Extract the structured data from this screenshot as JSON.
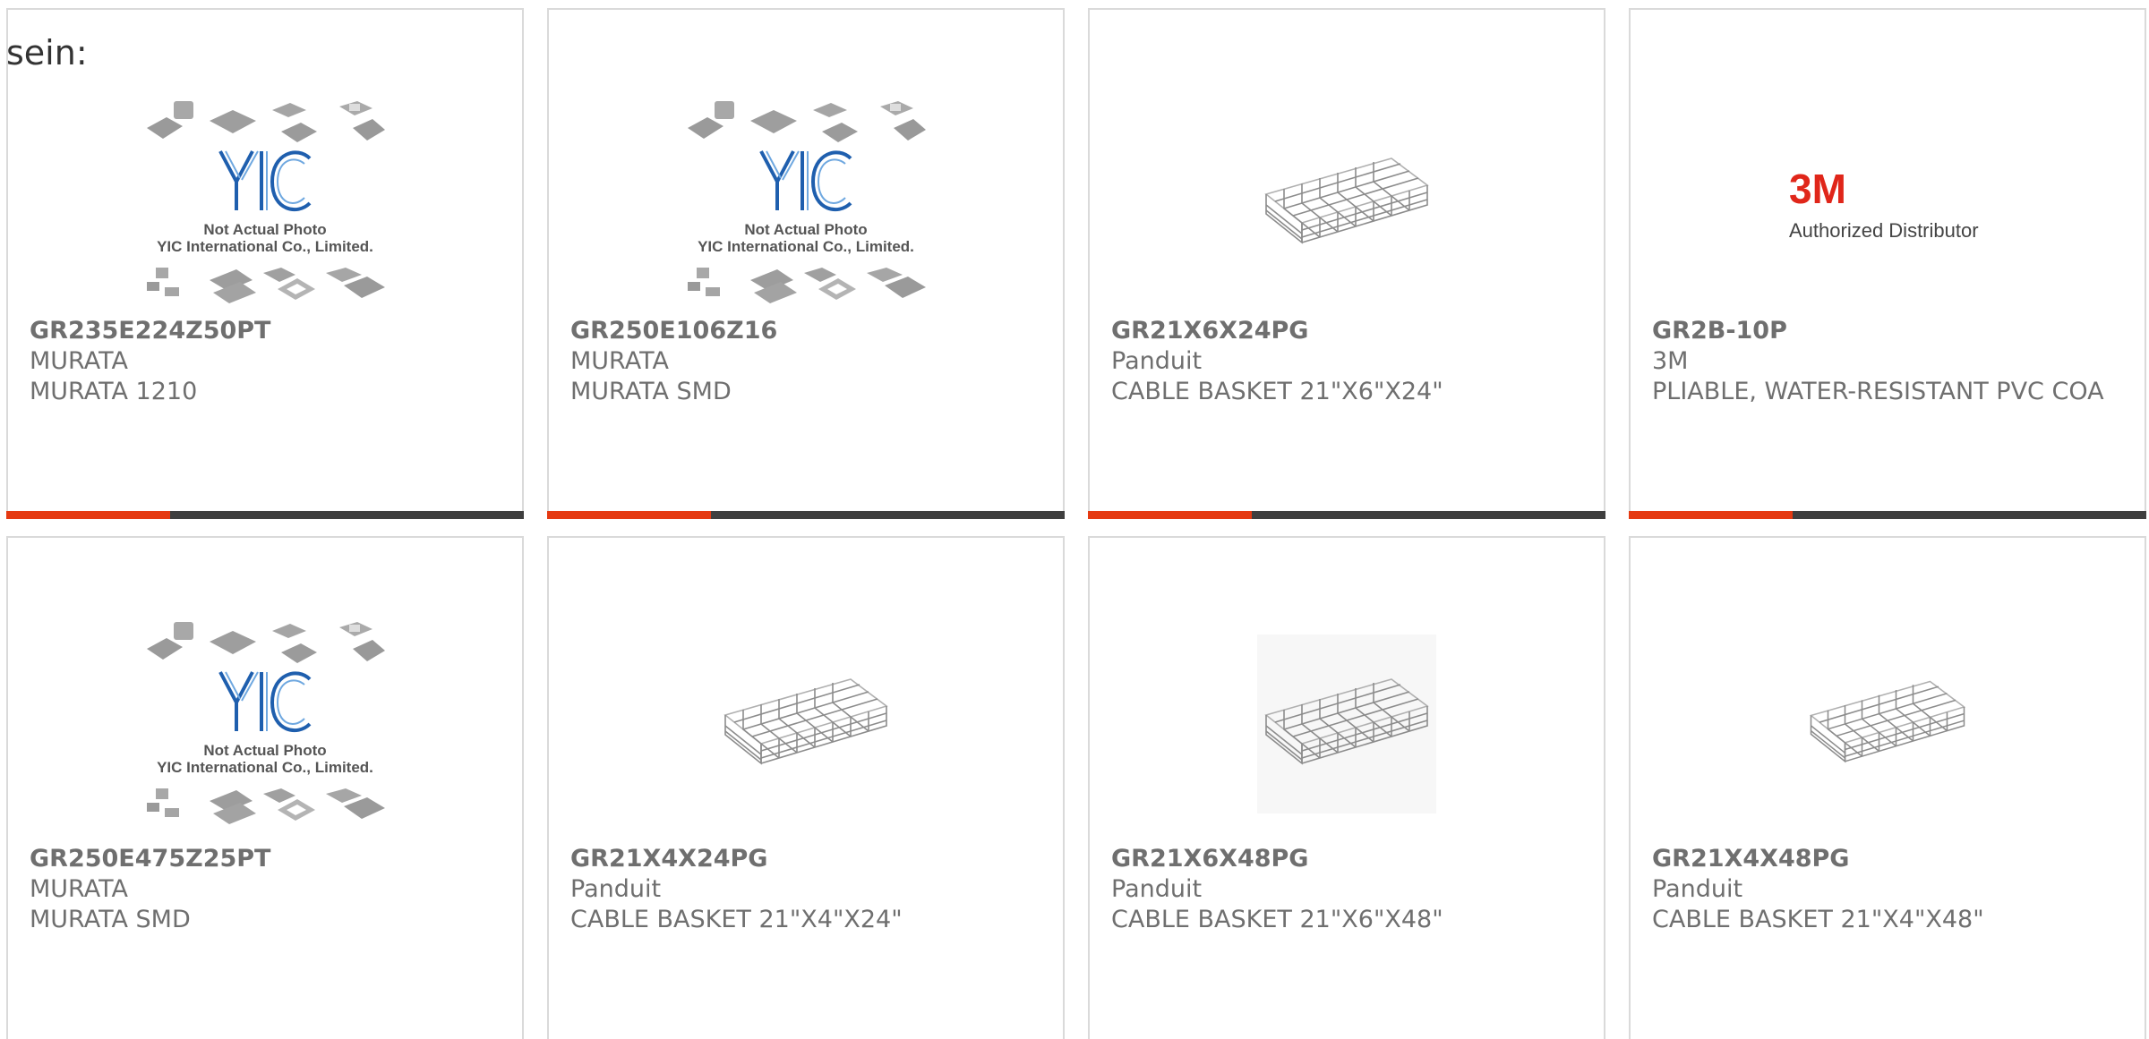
{
  "top_label": "sein:",
  "placeholder_image": {
    "line1": "Not Actual Photo",
    "line2": "YIC International Co., Limited.",
    "logo": "YIC"
  },
  "brand_3m": {
    "logo": "3M",
    "caption": "Authorized Distributor"
  },
  "colors": {
    "accent": "#e53a12",
    "bar": "#3f3f3f",
    "text": "#6f6f6f",
    "border": "#dadada",
    "yic_blue": "#1f5fae",
    "logo_3m": "#e0261a"
  },
  "products": [
    {
      "part": "GR235E224Z50PT",
      "maker": "MURATA",
      "desc": "MURATA 1210",
      "image": "yic-placeholder"
    },
    {
      "part": "GR250E106Z16",
      "maker": "MURATA",
      "desc": "MURATA SMD",
      "image": "yic-placeholder"
    },
    {
      "part": "GR21X6X24PG",
      "maker": "Panduit",
      "desc": "CABLE BASKET 21\"X6\"X24\"",
      "image": "cable-basket"
    },
    {
      "part": "GR2B-10P",
      "maker": "3M",
      "desc": "PLIABLE, WATER-RESISTANT PVC COA",
      "image": "3m-logo"
    },
    {
      "part": "GR250E475Z25PT",
      "maker": "MURATA",
      "desc": "MURATA SMD",
      "image": "yic-placeholder"
    },
    {
      "part": "GR21X4X24PG",
      "maker": "Panduit",
      "desc": "CABLE BASKET 21\"X4\"X24\"",
      "image": "cable-basket"
    },
    {
      "part": "GR21X6X48PG",
      "maker": "Panduit",
      "desc": "CABLE BASKET 21\"X6\"X48\"",
      "image": "cable-basket-long"
    },
    {
      "part": "GR21X4X48PG",
      "maker": "Panduit",
      "desc": "CABLE BASKET 21\"X4\"X48\"",
      "image": "cable-basket-long"
    }
  ]
}
